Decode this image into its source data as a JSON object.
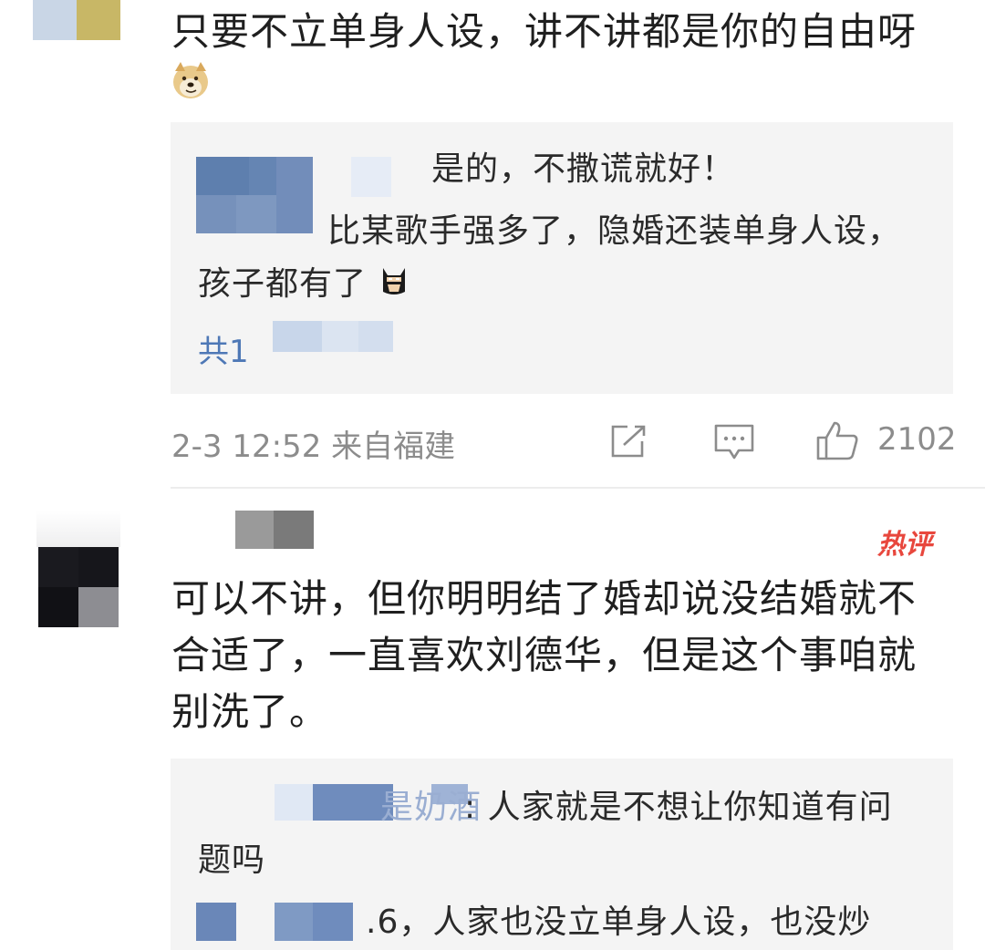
{
  "comment1": {
    "text": "只要不立单身人设，讲不讲都是你的自由呀",
    "emoji_icon": "doge-emoji",
    "replies": [
      {
        "text": "是的，不撒谎就好！"
      },
      {
        "text_line1": "比某歌手强多了，隐婚还装单身人设，",
        "text_line2": "孩子都有了",
        "emoji_icon": "batman-emoji"
      }
    ],
    "more_replies": "共1",
    "meta": "2-3 12:52 来自福建",
    "like_count": "2102"
  },
  "comment2": {
    "badge": "热评",
    "text_lines": [
      "可以不讲，但你明明结了婚却说没结婚就不",
      "合适了，一直喜欢刘德华，但是这个事咱就",
      "别洗了。"
    ],
    "replies": [
      {
        "name_fragment": "是奶酒",
        "text_line1": ": 人家就是不想让你知道有问",
        "text_line2": "题吗"
      },
      {
        "text": ".6，人家也没立单身人设，也没炒"
      }
    ]
  },
  "colors": {
    "link": "#4e78b6",
    "hot_badge": "#e8473d",
    "meta_gray": "#8c8c8c",
    "reply_bg": "#f4f4f4"
  }
}
